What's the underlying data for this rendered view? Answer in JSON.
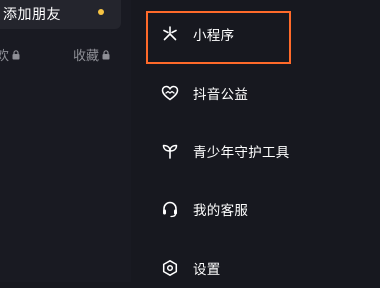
{
  "left": {
    "add_friend_label": "添加朋友",
    "tab_left_label": "欢",
    "tab_right_label": "收藏"
  },
  "menu": {
    "items": [
      {
        "label": "小程序",
        "icon": "mini-program-icon"
      },
      {
        "label": "抖音公益",
        "icon": "charity-heart-icon"
      },
      {
        "label": "青少年守护工具",
        "icon": "sprout-icon"
      },
      {
        "label": "我的客服",
        "icon": "headset-icon"
      },
      {
        "label": "设置",
        "icon": "settings-hexagon-icon"
      }
    ]
  },
  "colors": {
    "highlight": "#ff6a2a",
    "notify_dot": "#f7c443",
    "background": "#17181f"
  }
}
